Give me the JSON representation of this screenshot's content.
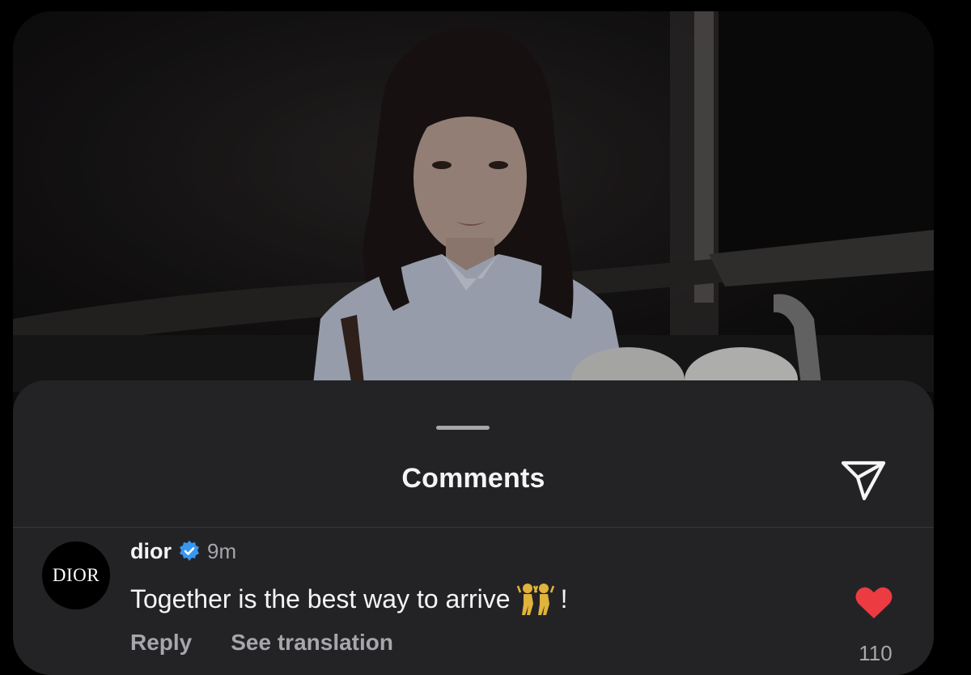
{
  "sheet": {
    "title": "Comments"
  },
  "icons": {
    "share": "paper-plane-icon",
    "verified": "verified-badge-icon",
    "like": "heart-icon",
    "emoji": "dancers-emoji"
  },
  "colors": {
    "verified": "#3897f0",
    "like": "#ed3b42",
    "sheet_bg": "#232326",
    "muted_text": "#a6a6ab"
  },
  "comment": {
    "avatar_text": "DIOR",
    "username": "dior",
    "time": "9m",
    "text": "Together is the best way to arrive",
    "text_suffix": "!",
    "reply_label": "Reply",
    "translate_label": "See translation",
    "like_count": "110",
    "liked": true
  }
}
